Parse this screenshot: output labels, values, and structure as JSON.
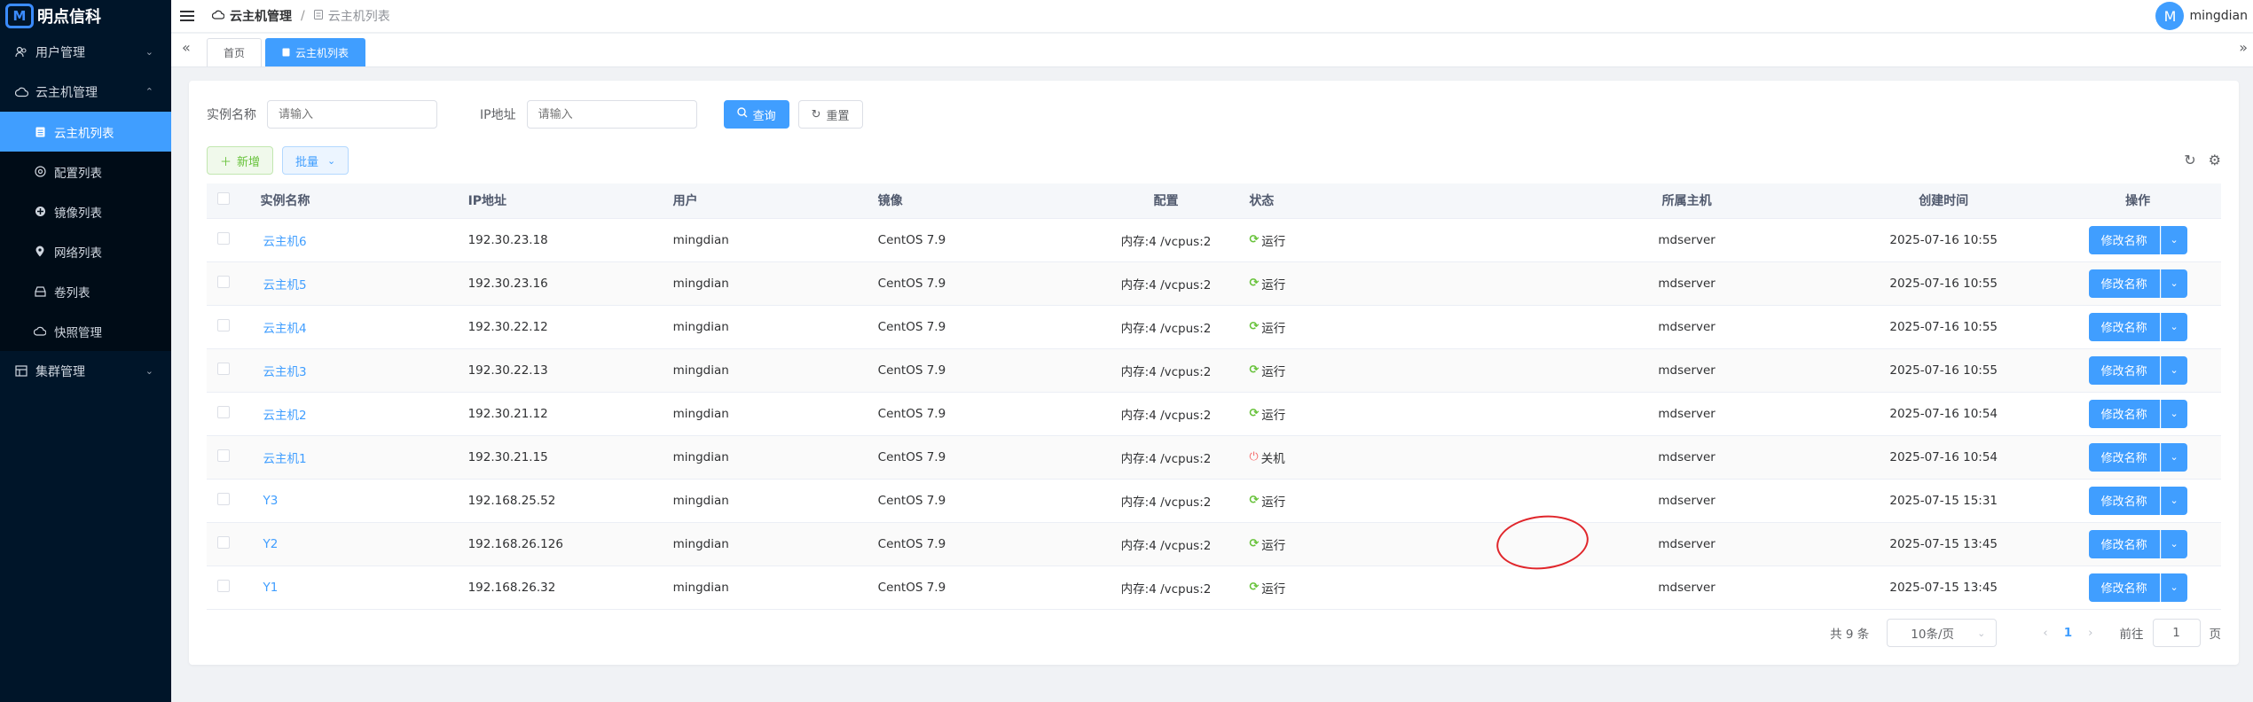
{
  "brand": {
    "logo_text": "M",
    "name": "明点信科"
  },
  "sidebar": {
    "items": [
      {
        "label": "用户管理",
        "icon": "users-icon",
        "expanded": false
      },
      {
        "label": "云主机管理",
        "icon": "cloud-icon",
        "expanded": true
      },
      {
        "label": "集群管理",
        "icon": "cluster-icon",
        "expanded": false
      }
    ],
    "sub_items": [
      {
        "label": "云主机列表",
        "icon": "list-icon",
        "active": true
      },
      {
        "label": "配置列表",
        "icon": "config-icon",
        "active": false
      },
      {
        "label": "镜像列表",
        "icon": "image-icon",
        "active": false
      },
      {
        "label": "网络列表",
        "icon": "network-icon",
        "active": false
      },
      {
        "label": "卷列表",
        "icon": "volume-icon",
        "active": false
      },
      {
        "label": "快照管理",
        "icon": "snapshot-icon",
        "active": false
      }
    ]
  },
  "header": {
    "breadcrumb": {
      "first": "云主机管理",
      "separator": "/",
      "second": "云主机列表"
    },
    "user": {
      "avatar_letter": "M",
      "name": "mingdian"
    }
  },
  "tabs": [
    {
      "label": "首页",
      "active": false
    },
    {
      "label": "云主机列表",
      "active": true
    }
  ],
  "search": {
    "name_label": "实例名称",
    "name_placeholder": "请输入",
    "ip_label": "IP地址",
    "ip_placeholder": "请输入",
    "query_label": "查询",
    "reset_label": "重置"
  },
  "toolbar": {
    "add_label": "新增",
    "batch_label": "批量"
  },
  "table": {
    "columns": [
      "实例名称",
      "IP地址",
      "用户",
      "镜像",
      "配置",
      "状态",
      "所属主机",
      "创建时间",
      "操作"
    ],
    "rows": [
      {
        "name": "云主机6",
        "ip": "192.30.23.18",
        "user": "mingdian",
        "image": "CentOS 7.9",
        "config": "内存:4 /vcpus:2",
        "status": "运行",
        "host": "mdserver",
        "created": "2025-07-16 10:55",
        "op": "修改名称"
      },
      {
        "name": "云主机5",
        "ip": "192.30.23.16",
        "user": "mingdian",
        "image": "CentOS 7.9",
        "config": "内存:4 /vcpus:2",
        "status": "运行",
        "host": "mdserver",
        "created": "2025-07-16 10:55",
        "op": "修改名称"
      },
      {
        "name": "云主机4",
        "ip": "192.30.22.12",
        "user": "mingdian",
        "image": "CentOS 7.9",
        "config": "内存:4 /vcpus:2",
        "status": "运行",
        "host": "mdserver",
        "created": "2025-07-16 10:55",
        "op": "修改名称"
      },
      {
        "name": "云主机3",
        "ip": "192.30.22.13",
        "user": "mingdian",
        "image": "CentOS 7.9",
        "config": "内存:4 /vcpus:2",
        "status": "运行",
        "host": "mdserver",
        "created": "2025-07-16 10:55",
        "op": "修改名称"
      },
      {
        "name": "云主机2",
        "ip": "192.30.21.12",
        "user": "mingdian",
        "image": "CentOS 7.9",
        "config": "内存:4 /vcpus:2",
        "status": "运行",
        "host": "mdserver",
        "created": "2025-07-16 10:54",
        "op": "修改名称"
      },
      {
        "name": "云主机1",
        "ip": "192.30.21.15",
        "user": "mingdian",
        "image": "CentOS 7.9",
        "config": "内存:4 /vcpus:2",
        "status": "关机",
        "host": "mdserver",
        "created": "2025-07-16 10:54",
        "op": "修改名称"
      },
      {
        "name": "Y3",
        "ip": "192.168.25.52",
        "user": "mingdian",
        "image": "CentOS 7.9",
        "config": "内存:4 /vcpus:2",
        "status": "运行",
        "host": "mdserver",
        "created": "2025-07-15 15:31",
        "op": "修改名称"
      },
      {
        "name": "Y2",
        "ip": "192.168.26.126",
        "user": "mingdian",
        "image": "CentOS 7.9",
        "config": "内存:4 /vcpus:2",
        "status": "运行",
        "host": "mdserver",
        "created": "2025-07-15 13:45",
        "op": "修改名称"
      },
      {
        "name": "Y1",
        "ip": "192.168.26.32",
        "user": "mingdian",
        "image": "CentOS 7.9",
        "config": "内存:4 /vcpus:2",
        "status": "运行",
        "host": "mdserver",
        "created": "2025-07-15 13:45",
        "op": "修改名称"
      }
    ]
  },
  "pagination": {
    "total_text": "共 9 条",
    "page_size": "10条/页",
    "current_page": "1",
    "goto_label": "前往",
    "goto_value": "1",
    "page_suffix": "页"
  },
  "colors": {
    "primary": "#409eff",
    "sidebar_bg": "#001529",
    "success": "#67c23a",
    "danger": "#f56c6c",
    "annotation": "#e0262b"
  }
}
